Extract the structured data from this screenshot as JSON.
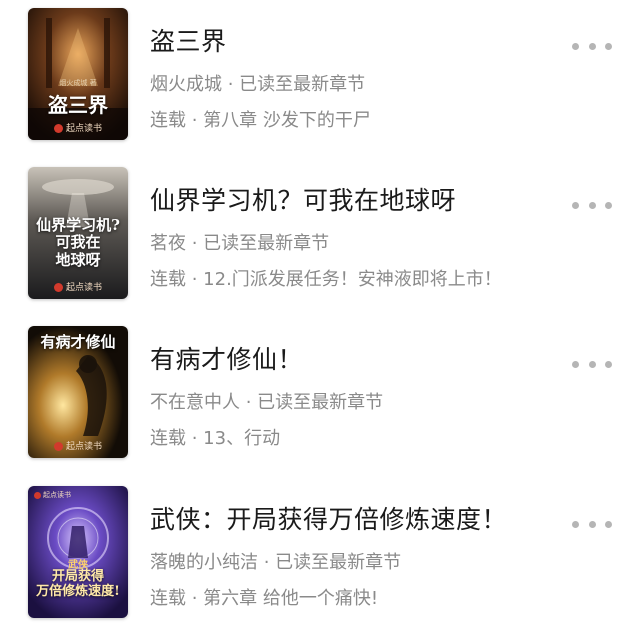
{
  "books": [
    {
      "title": "盗三界",
      "meta": "烟火成城 · 已读至最新章节",
      "progress": "连载 · 第八章 沙发下的干尸",
      "cover_title": "盗三界",
      "cover_author": "烟火成城 著",
      "publisher": "起点读书"
    },
    {
      "title": "仙界学习机？可我在地球呀",
      "meta": "茗夜 · 已读至最新章节",
      "progress": "连载 · 12.门派发展任务！安神液即将上市！",
      "cover_title": "仙界学习机?\n可我在\n地球呀",
      "publisher": "起点读书"
    },
    {
      "title": "有病才修仙！",
      "meta": "不在意中人 · 已读至最新章节",
      "progress": "连载 · 13、行动",
      "cover_title": "有病才修仙",
      "publisher": "起点读书"
    },
    {
      "title": "武侠：开局获得万倍修炼速度！",
      "meta": "落魄的小纯洁 · 已读至最新章节",
      "progress": "连载 · 第六章 给他一个痛快!",
      "cover_title": "开局获得\n万倍修炼速度!",
      "cover_tag": "武侠",
      "publisher": "起点读书"
    }
  ]
}
